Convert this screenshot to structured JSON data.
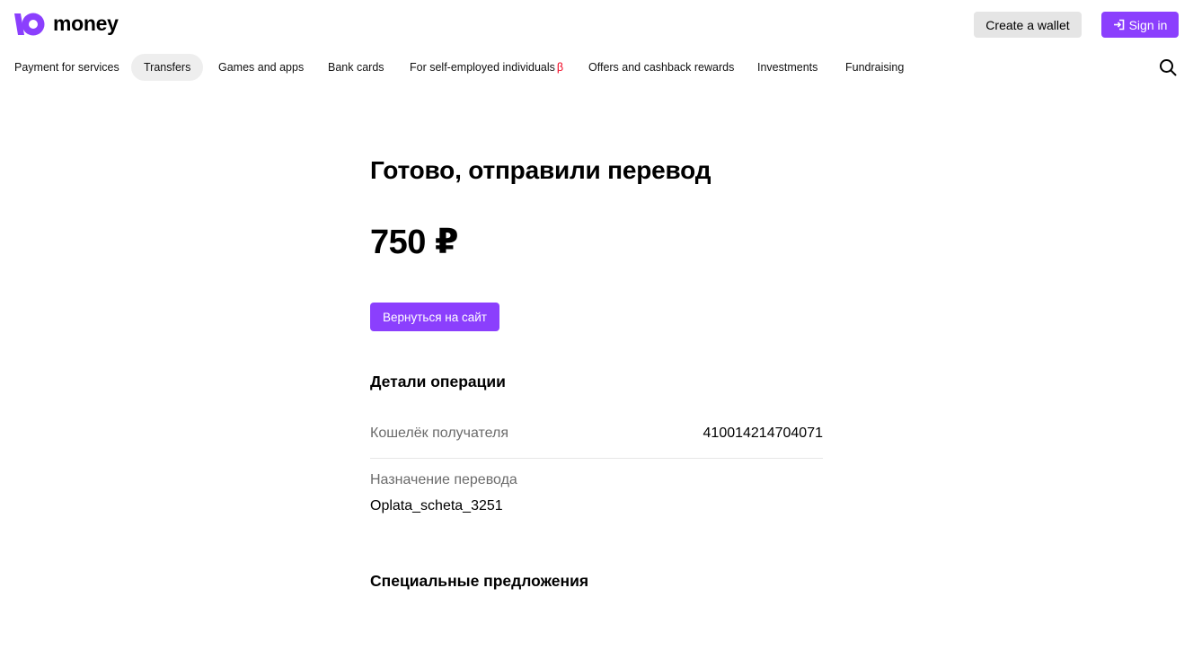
{
  "colors": {
    "brand": "#8b3ffd",
    "nav_active_bg": "#eeeeee",
    "beta": "#f1001e",
    "muted_text": "#6b6b6b"
  },
  "header": {
    "logo_text": "money",
    "logo_icon": "yoomoney-logo-icon",
    "create_wallet_label": "Create a wallet",
    "sign_in_label": "Sign in",
    "sign_in_icon": "sign-in-icon"
  },
  "nav": {
    "items": [
      {
        "label": "Payment for services",
        "active": false
      },
      {
        "label": "Transfers",
        "active": true
      },
      {
        "label": "Games and apps",
        "active": false
      },
      {
        "label": "Bank cards",
        "active": false
      },
      {
        "label": "For self-employed individuals",
        "badge": "β",
        "active": false
      },
      {
        "label": "Offers and cashback rewards",
        "active": false
      },
      {
        "label": "Investments",
        "active": false
      },
      {
        "label": "Fundraising",
        "active": false
      }
    ],
    "search_icon": "search-icon"
  },
  "main": {
    "title": "Готово, отправили перевод",
    "amount": "750 ₽",
    "back_button_label": "Вернуться на сайт",
    "details": {
      "title": "Детали операции",
      "wallet_label": "Кошелёк получателя",
      "wallet_value": "410014214704071",
      "purpose_label": "Назначение перевода",
      "purpose_value": "Oplata_scheta_3251"
    },
    "offers_title": "Специальные предложения"
  }
}
